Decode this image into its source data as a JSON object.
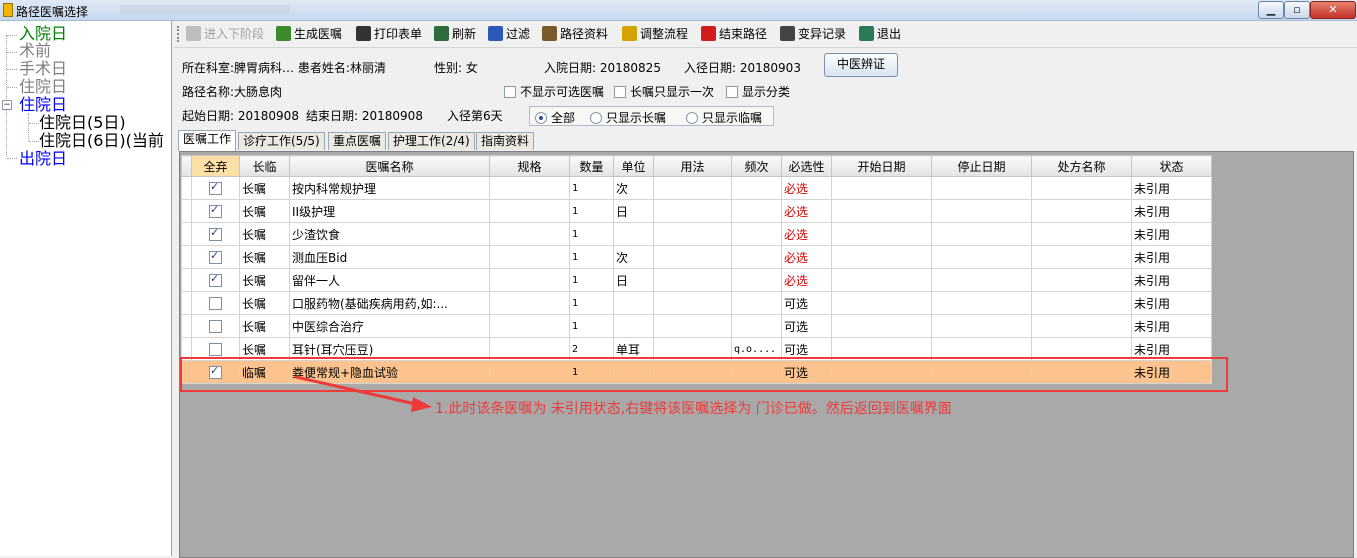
{
  "window": {
    "title": "路径医嘱选择",
    "min_label": "▁",
    "max_label": "▫",
    "close_label": "✕"
  },
  "tree": {
    "nodes": [
      {
        "label": "入院日",
        "color": "#008000"
      },
      {
        "label": "术前",
        "color": "#808080"
      },
      {
        "label": "手术日",
        "color": "#808080"
      },
      {
        "label": "住院日",
        "color": "#808080"
      },
      {
        "label": "住院日",
        "color": "#0000ff"
      },
      {
        "label": "住院日(5日)",
        "color": "#000000"
      },
      {
        "label": "住院日(6日)(当前",
        "color": "#000000"
      },
      {
        "label": "出院日",
        "color": "#0000ff"
      }
    ],
    "expander_label": "−"
  },
  "toolbar": {
    "items": [
      {
        "label": "进入下阶段",
        "icon": "next-stage-icon",
        "color": "#bdbdbd",
        "disabled": true
      },
      {
        "label": "生成医嘱",
        "icon": "generate-order-icon",
        "color": "#3b8a2b"
      },
      {
        "label": "打印表单",
        "icon": "printer-icon",
        "color": "#333333"
      },
      {
        "label": "刷新",
        "icon": "refresh-icon",
        "color": "#2e6b3e"
      },
      {
        "label": "过滤",
        "icon": "filter-icon",
        "color": "#2a5ab5"
      },
      {
        "label": "路径资料",
        "icon": "book-icon",
        "color": "#7a5a2a"
      },
      {
        "label": "调整流程",
        "icon": "process-icon",
        "color": "#d6a200"
      },
      {
        "label": "结束路径",
        "icon": "stop-icon",
        "color": "#d21b1b"
      },
      {
        "label": "变异记录",
        "icon": "calculator-icon",
        "color": "#444444"
      },
      {
        "label": "退出",
        "icon": "exit-icon",
        "color": "#2a7a5a"
      }
    ]
  },
  "patient": {
    "dept_label": "所在科室:",
    "dept_value": "脾胃病科…",
    "name_label": "患者姓名:",
    "name_value": "林丽清",
    "sex_label": "性别:",
    "sex_value": "女",
    "admit_label": "入院日期:",
    "admit_value": "20180825",
    "path_in_label": "入径日期:",
    "path_in_value": "20180903",
    "path_name_label": "路径名称:",
    "path_name_value": "大肠息肉",
    "start_label": "起始日期:",
    "start_value": "20180908",
    "end_label": "结束日期:",
    "end_value": "20180908",
    "day_label": "入径第6天"
  },
  "tcm_button": "中医辨证",
  "options": {
    "hide_optional": "不显示可选医嘱",
    "long_once": "长嘱只显示一次",
    "show_category": "显示分类"
  },
  "radio_filter": {
    "options": [
      "全部",
      "只显示长嘱",
      "只显示临嘱"
    ],
    "selected": "全部"
  },
  "tabs": [
    {
      "label": "医嘱工作",
      "active": true
    },
    {
      "label": "诊疗工作(5/5)"
    },
    {
      "label": "重点医嘱"
    },
    {
      "label": "护理工作(2/4)"
    },
    {
      "label": "指南资料"
    }
  ],
  "grid": {
    "columns": [
      "全弃",
      "长临",
      "医嘱名称",
      "规格",
      "数量",
      "单位",
      "用法",
      "频次",
      "必选性",
      "开始日期",
      "停止日期",
      "处方名称",
      "状态"
    ],
    "rows": [
      {
        "checked": true,
        "type": "长嘱",
        "name": "按内科常规护理",
        "spec": "",
        "qty": "1",
        "unit": "次",
        "usage": "",
        "freq": "",
        "required": "必选",
        "start": "",
        "stop": "",
        "rx": "",
        "status": "未引用"
      },
      {
        "checked": true,
        "type": "长嘱",
        "name": "II级护理",
        "spec": "",
        "qty": "1",
        "unit": "日",
        "usage": "",
        "freq": "",
        "required": "必选",
        "start": "",
        "stop": "",
        "rx": "",
        "status": "未引用"
      },
      {
        "checked": true,
        "type": "长嘱",
        "name": "少渣饮食",
        "spec": "",
        "qty": "1",
        "unit": "",
        "usage": "",
        "freq": "",
        "required": "必选",
        "start": "",
        "stop": "",
        "rx": "",
        "status": "未引用"
      },
      {
        "checked": true,
        "type": "长嘱",
        "name": "测血压Bid",
        "spec": "",
        "qty": "1",
        "unit": "次",
        "usage": "",
        "freq": "",
        "required": "必选",
        "start": "",
        "stop": "",
        "rx": "",
        "status": "未引用"
      },
      {
        "checked": true,
        "type": "长嘱",
        "name": "留伴一人",
        "spec": "",
        "qty": "1",
        "unit": "日",
        "usage": "",
        "freq": "",
        "required": "必选",
        "start": "",
        "stop": "",
        "rx": "",
        "status": "未引用"
      },
      {
        "checked": false,
        "type": "长嘱",
        "name": "口服药物(基础疾病用药,如:...",
        "spec": "",
        "qty": "1",
        "unit": "",
        "usage": "",
        "freq": "",
        "required": "可选",
        "start": "",
        "stop": "",
        "rx": "",
        "status": "未引用"
      },
      {
        "checked": false,
        "type": "长嘱",
        "name": "中医综合治疗",
        "spec": "",
        "qty": "1",
        "unit": "",
        "usage": "",
        "freq": "",
        "required": "可选",
        "start": "",
        "stop": "",
        "rx": "",
        "status": "未引用"
      },
      {
        "checked": false,
        "type": "长嘱",
        "name": "耳针(耳穴压豆)",
        "spec": "",
        "qty": "2",
        "unit": "单耳",
        "usage": "",
        "freq": "q.o....",
        "required": "可选",
        "start": "",
        "stop": "",
        "rx": "",
        "status": "未引用"
      },
      {
        "checked": true,
        "type": "临嘱",
        "name": "粪便常规+隐血试验",
        "spec": "",
        "qty": "1",
        "unit": "",
        "usage": "",
        "freq": "",
        "required": "可选",
        "start": "",
        "stop": "",
        "rx": "",
        "status": "未引用",
        "selected": true
      }
    ]
  },
  "annotation": {
    "text": "1.此时该条医嘱为   未引用状态,右键将该医嘱选择为    门诊已做。然后返回到医嘱界面",
    "color": "#ef3a3a"
  }
}
